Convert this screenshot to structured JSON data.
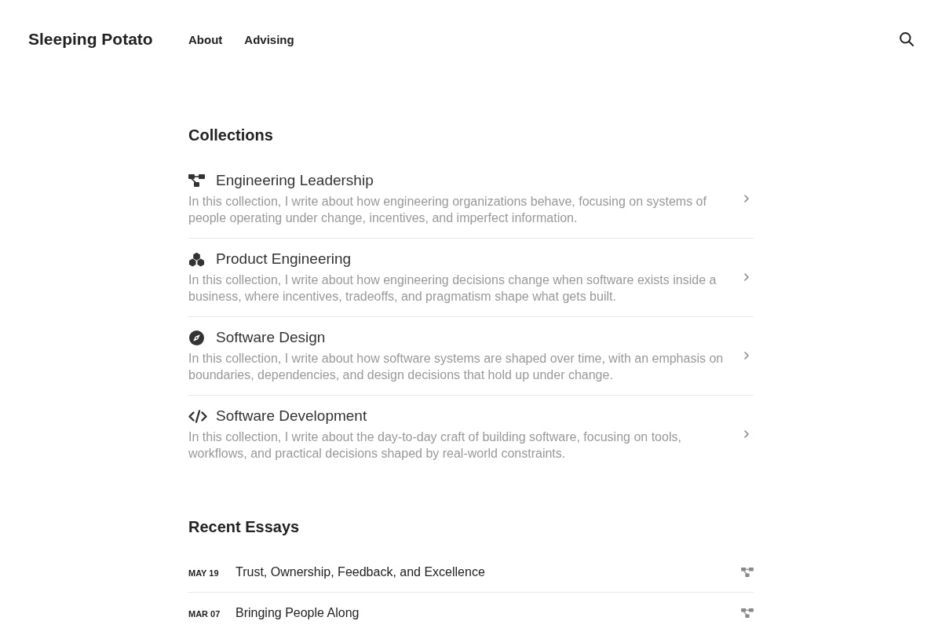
{
  "header": {
    "logo": "Sleeping Potato",
    "nav": [
      "About",
      "Advising"
    ]
  },
  "collections": {
    "title": "Collections",
    "items": [
      {
        "kind": "leadership",
        "title": "Engineering Leadership",
        "description": "In this collection, I write about how engineering organizations behave, focusing on systems of people operating under change, incentives, and imperfect information."
      },
      {
        "kind": "product",
        "title": "Product Engineering",
        "description": "In this collection, I write about how engineering decisions change when software exists inside a business, where incentives, tradeoffs, and pragmatism shape what gets built."
      },
      {
        "kind": "design",
        "title": "Software Design",
        "description": "In this collection, I write about how software systems are shaped over time, with an emphasis on boundaries, dependencies, and design decisions that hold up under change."
      },
      {
        "kind": "development",
        "title": "Software Development",
        "description": "In this collection, I write about the day-to-day craft of building software, focusing on tools, workflows, and practical decisions shaped by real-world constraints."
      }
    ]
  },
  "recent_essays": {
    "title": "Recent Essays",
    "items": [
      {
        "date": "MAY 19",
        "title": "Trust, Ownership, Feedback, and Excellence",
        "kind": "leadership"
      },
      {
        "date": "MAR 07",
        "title": "Bringing People Along",
        "kind": "leadership"
      }
    ]
  }
}
